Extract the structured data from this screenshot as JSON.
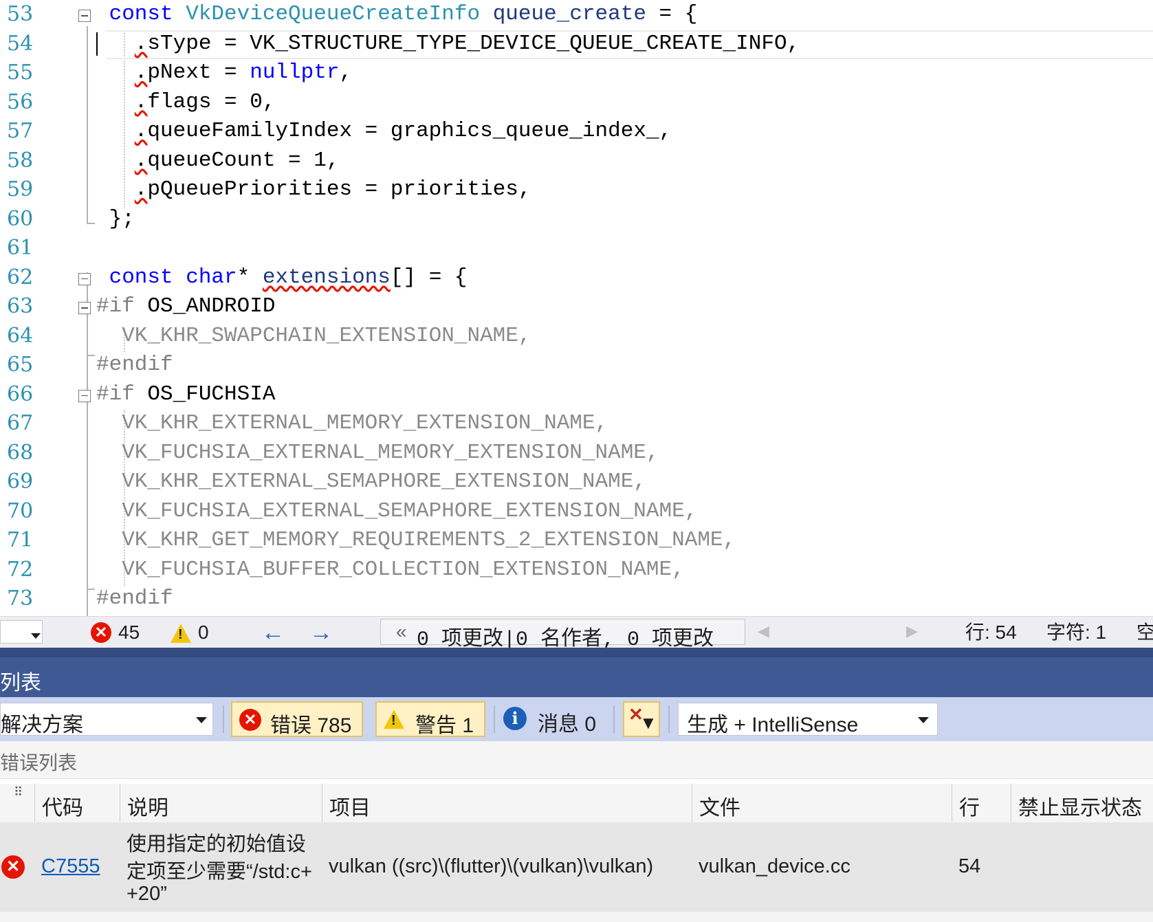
{
  "editor": {
    "current_line": "54",
    "lines": [
      {
        "num": "53",
        "parts": [
          {
            "c": "kw",
            "t": "const "
          },
          {
            "c": "ty",
            "t": "VkDeviceQueueCreateInfo"
          },
          {
            "c": "",
            "t": " "
          },
          {
            "c": "nm",
            "t": "queue_create"
          },
          {
            "c": "",
            "t": " = {"
          }
        ]
      },
      {
        "num": "54",
        "parts": [
          {
            "c": "sq",
            "t": "."
          },
          {
            "c": "",
            "t": "sType = VK_STRUCTURE_TYPE_DEVICE_QUEUE_CREATE_INFO,"
          }
        ]
      },
      {
        "num": "55",
        "parts": [
          {
            "c": "sq",
            "t": "."
          },
          {
            "c": "",
            "t": "pNext = "
          },
          {
            "c": "kw",
            "t": "nullptr"
          },
          {
            "c": "",
            "t": ","
          }
        ]
      },
      {
        "num": "56",
        "parts": [
          {
            "c": "sq",
            "t": "."
          },
          {
            "c": "",
            "t": "flags = 0,"
          }
        ]
      },
      {
        "num": "57",
        "parts": [
          {
            "c": "sq",
            "t": "."
          },
          {
            "c": "",
            "t": "queueFamilyIndex = graphics_queue_index_,"
          }
        ]
      },
      {
        "num": "58",
        "parts": [
          {
            "c": "sq",
            "t": "."
          },
          {
            "c": "",
            "t": "queueCount = 1,"
          }
        ]
      },
      {
        "num": "59",
        "parts": [
          {
            "c": "sq",
            "t": "."
          },
          {
            "c": "",
            "t": "pQueuePriorities = priorities,"
          }
        ]
      },
      {
        "num": "60",
        "parts": [
          {
            "c": "",
            "t": "};"
          }
        ]
      },
      {
        "num": "61",
        "parts": []
      },
      {
        "num": "62",
        "parts": [
          {
            "c": "kw",
            "t": "const "
          },
          {
            "c": "kw",
            "t": "char"
          },
          {
            "c": "",
            "t": "* "
          },
          {
            "c": "nmsq",
            "t": "extensions"
          },
          {
            "c": "",
            "t": "[] = {"
          }
        ]
      },
      {
        "num": "63",
        "parts": [
          {
            "c": "pp",
            "t": "#if"
          },
          {
            "c": "",
            "t": " OS_ANDROID"
          }
        ]
      },
      {
        "num": "64",
        "parts": [
          {
            "c": "dim",
            "t": "VK_KHR_SWAPCHAIN_EXTENSION_NAME,"
          }
        ]
      },
      {
        "num": "65",
        "parts": [
          {
            "c": "pp",
            "t": "#endif"
          }
        ]
      },
      {
        "num": "66",
        "parts": [
          {
            "c": "pp",
            "t": "#if"
          },
          {
            "c": "",
            "t": " OS_FUCHSIA"
          }
        ]
      },
      {
        "num": "67",
        "parts": [
          {
            "c": "dim",
            "t": "VK_KHR_EXTERNAL_MEMORY_EXTENSION_NAME,"
          }
        ]
      },
      {
        "num": "68",
        "parts": [
          {
            "c": "dim",
            "t": "VK_FUCHSIA_EXTERNAL_MEMORY_EXTENSION_NAME,"
          }
        ]
      },
      {
        "num": "69",
        "parts": [
          {
            "c": "dim",
            "t": "VK_KHR_EXTERNAL_SEMAPHORE_EXTENSION_NAME,"
          }
        ]
      },
      {
        "num": "70",
        "parts": [
          {
            "c": "dim",
            "t": "VK_FUCHSIA_EXTERNAL_SEMAPHORE_EXTENSION_NAME,"
          }
        ]
      },
      {
        "num": "71",
        "parts": [
          {
            "c": "dim",
            "t": "VK_KHR_GET_MEMORY_REQUIREMENTS_2_EXTENSION_NAME,"
          }
        ]
      },
      {
        "num": "72",
        "parts": [
          {
            "c": "dim",
            "t": "VK_FUCHSIA_BUFFER_COLLECTION_EXTENSION_NAME,"
          }
        ]
      },
      {
        "num": "73",
        "parts": [
          {
            "c": "pp",
            "t": "#endif"
          }
        ]
      }
    ]
  },
  "status": {
    "error_count": "45",
    "warning_count": "0",
    "codelens": "0 项更改|0 名作者, 0 项更改",
    "line": "行: 54",
    "char": "字符: 1",
    "space": "空"
  },
  "panel": {
    "title": "列表",
    "scope": "解决方案",
    "errors_label": "错误 785",
    "warnings_label": "警告 1",
    "messages_label": "消息 0",
    "build_filter": "生成 + IntelliSense",
    "search_placeholder": "错误列表"
  },
  "table": {
    "columns": [
      "代码",
      "说明",
      "项目",
      "文件",
      "行",
      "禁止显示状态"
    ],
    "row": {
      "code": "C7555",
      "desc_line1": "使用指定的初始值设",
      "desc_line2": "定项至少需要“/std:c+",
      "desc_line3": "+20”",
      "project": "vulkan ((src)\\(flutter)\\(vulkan)\\vulkan)",
      "file": "vulkan_device.cc",
      "line": "54",
      "suppress": ""
    }
  }
}
